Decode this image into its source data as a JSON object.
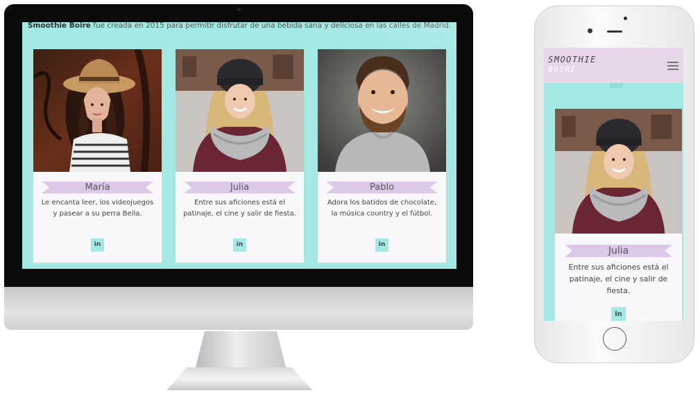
{
  "desktop": {
    "intro_brand": "Smoothie Boire",
    "intro_rest": " fue creada en 2015 para permitir disfrutar de una bebida sana y deliciosa en las calles de Madrid.",
    "team": [
      {
        "name": "María",
        "description": "Le encanta leer, los videojuegos y pasear a su perra Beila.",
        "social": "in",
        "photo_icon": "woman-hat-photo"
      },
      {
        "name": "Julia",
        "description": "Entre sus aficiones está el patinaje, el cine y salir de fiesta.",
        "social": "in",
        "photo_icon": "woman-beanie-photo"
      },
      {
        "name": "Pablo",
        "description": "Adora los batidos de chocolate, la música country y el fútbol.",
        "social": "in",
        "photo_icon": "man-smiling-photo"
      }
    ]
  },
  "mobile": {
    "logo_line1": "SMOOTHIE",
    "logo_line2": "BOIRE",
    "menu_icon": "hamburger-icon",
    "card": {
      "name": "Julia",
      "description": "Entre sus aficiones está el patinaje, el cine y salir de fiesta.",
      "social": "in"
    }
  },
  "colors": {
    "accent_aqua": "#a4e8e3",
    "ribbon_lilac": "#dcc9e8",
    "header_lilac": "#e7d6ea",
    "card_bg": "#f8f8fa"
  }
}
